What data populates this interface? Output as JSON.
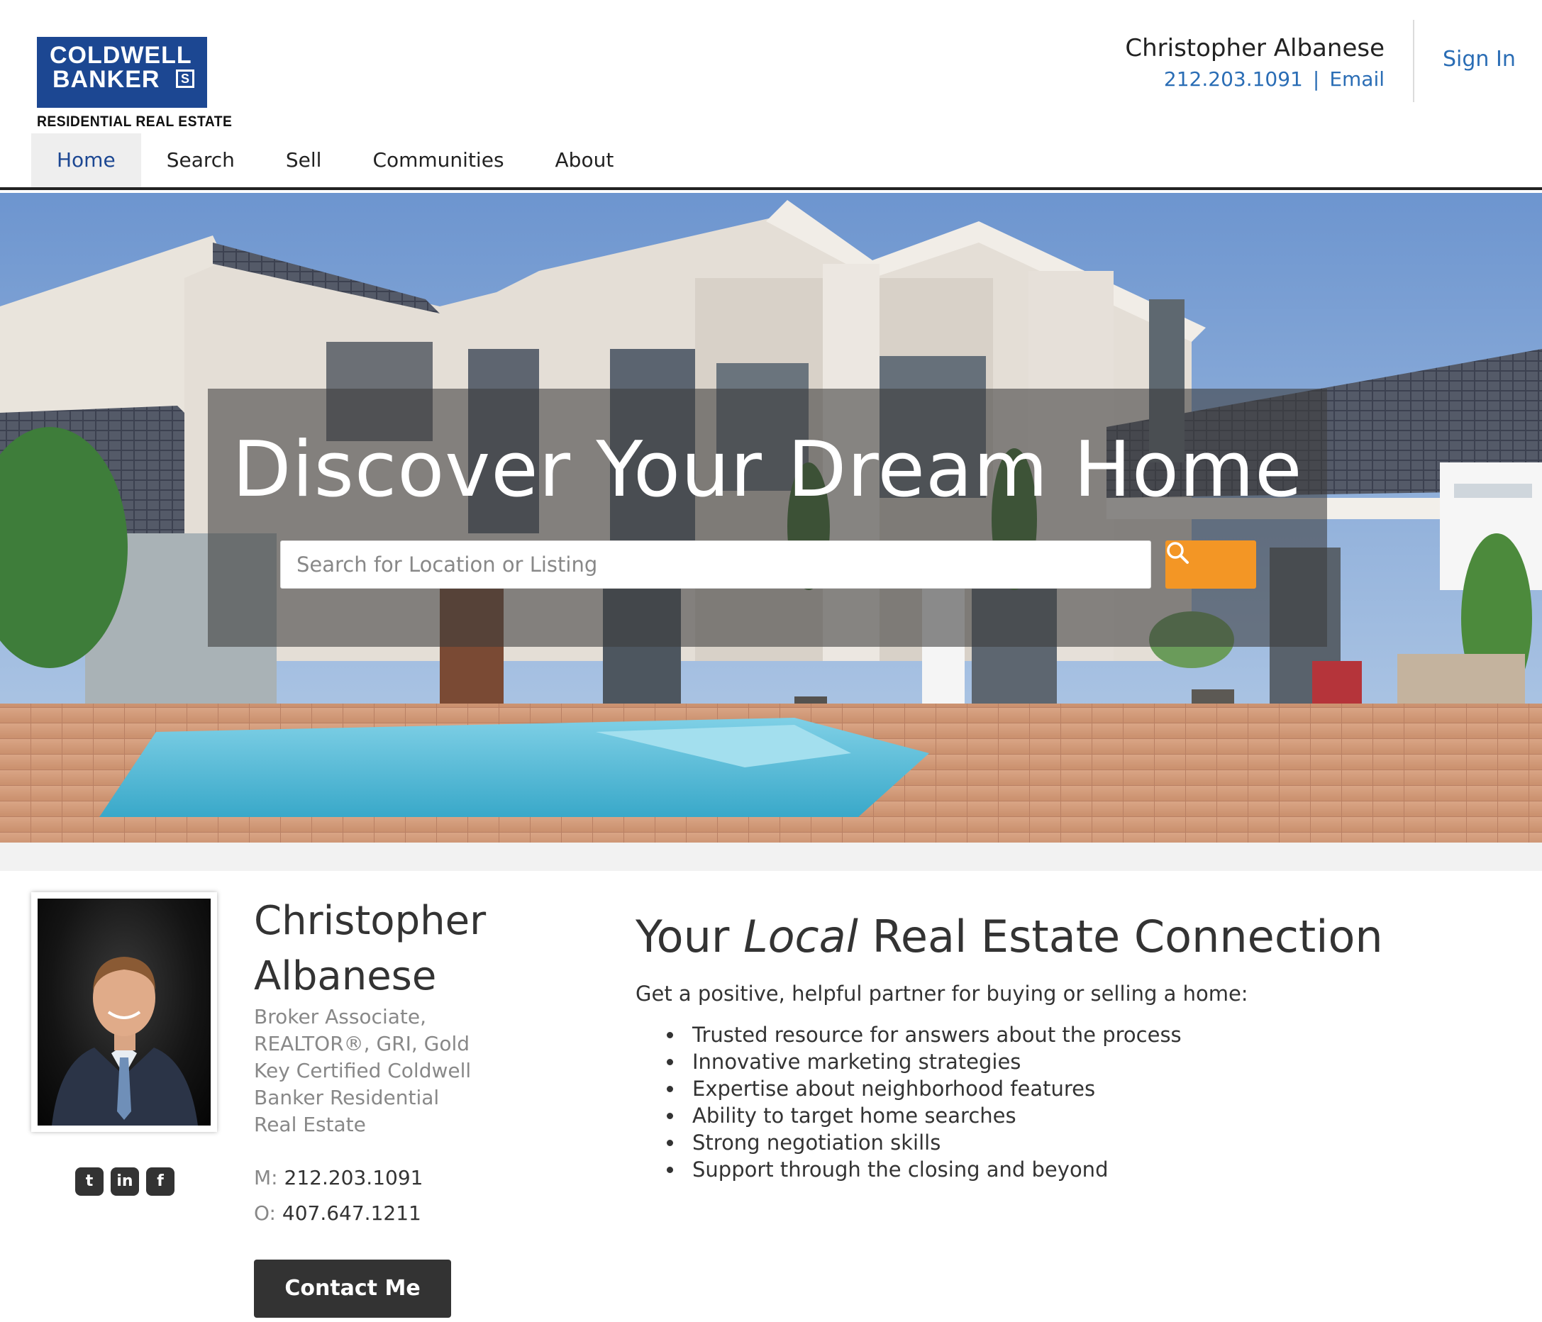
{
  "brand": {
    "logo_line1": "COLDWELL",
    "logo_line2": "BANKER",
    "logo_mark": "S",
    "logo_sub": "RESIDENTIAL REAL ESTATE",
    "colors": {
      "brand_blue": "#1c4792",
      "link_blue": "#2a6db5",
      "search_orange": "#f39625",
      "dark_button": "#333333"
    }
  },
  "header": {
    "agent_name": "Christopher Albanese",
    "phone": "212.203.1091",
    "separator": "|",
    "email_label": "Email",
    "sign_in": "Sign In"
  },
  "nav": {
    "items": [
      {
        "label": "Home",
        "active": true
      },
      {
        "label": "Search"
      },
      {
        "label": "Sell"
      },
      {
        "label": "Communities"
      },
      {
        "label": "About"
      }
    ]
  },
  "hero": {
    "title": "Discover Your Dream Home",
    "search_placeholder": "Search for Location or Listing",
    "search_icon": "search-icon"
  },
  "agent": {
    "name": "Christopher Albanese",
    "title": "Broker Associate, REALTOR®, GRI, Gold Key Certified Coldwell Banker Residential Real Estate",
    "mobile_label": "M:",
    "mobile": "212.203.1091",
    "office_label": "O:",
    "office": "407.647.1211",
    "contact_button": "Contact Me",
    "social": [
      {
        "icon": "twitter-icon",
        "glyph": "t"
      },
      {
        "icon": "linkedin-icon",
        "glyph": "in"
      },
      {
        "icon": "facebook-icon",
        "glyph": "f"
      }
    ]
  },
  "connection": {
    "heading_pre": "Your ",
    "heading_em": "Local",
    "heading_post": " Real Estate Connection",
    "intro": "Get a positive, helpful partner for buying or selling a home:",
    "items": [
      "Trusted resource for answers about the process",
      "Innovative marketing strategies",
      "Expertise about neighborhood features",
      "Ability to target home searches",
      "Strong negotiation skills",
      "Support through the closing and beyond"
    ]
  }
}
